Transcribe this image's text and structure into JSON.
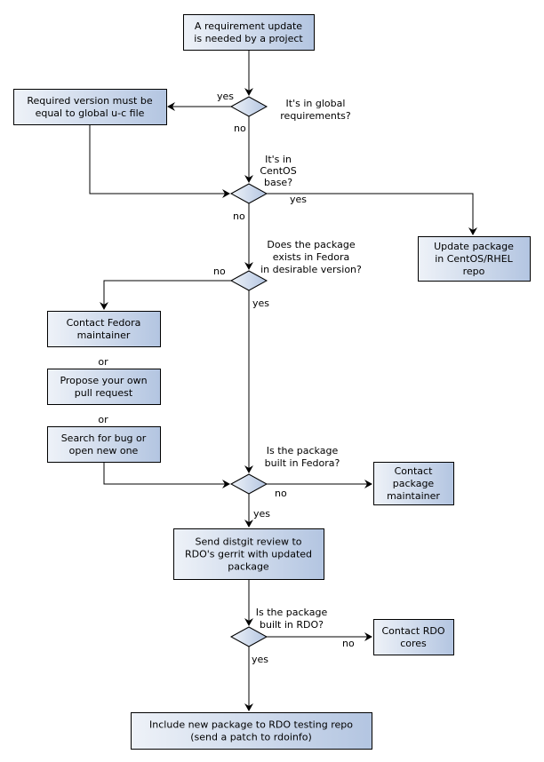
{
  "colors": {
    "fill_light": "#eef2f8",
    "fill_dark": "#b3c5e1",
    "stroke": "#000000"
  },
  "nodes": {
    "start": [
      "A requirement update",
      "is needed by a project"
    ],
    "global_eq": [
      "Required version must be",
      "equal to global u-c file"
    ],
    "update_centos": [
      "Update package",
      "in CentOS/RHEL",
      "repo"
    ],
    "contact_fedora": [
      "Contact Fedora",
      "maintainer"
    ],
    "propose_pr": [
      "Propose your own",
      "pull request"
    ],
    "search_bug": [
      "Search for bug or",
      "open new one"
    ],
    "contact_pkg": [
      "Contact",
      "package",
      "maintainer"
    ],
    "distgit": [
      "Send distgit review to",
      "RDO's gerrit with updated",
      "package"
    ],
    "contact_rdo": [
      "Contact RDO",
      "cores"
    ],
    "include": [
      "Include new package to RDO testing repo",
      "(send a patch to rdoinfo)"
    ]
  },
  "decisions": {
    "d1": [
      "It's in global",
      "requirements?"
    ],
    "d2": [
      "It's in",
      "CentOS",
      "base?"
    ],
    "d3": [
      "Does the package",
      "exists in Fedora",
      "in desirable version?"
    ],
    "d4": [
      "Is the package",
      "built in Fedora?"
    ],
    "d5": [
      "Is the package",
      "built in RDO?"
    ]
  },
  "labels": {
    "yes": "yes",
    "no": "no",
    "or": "or"
  }
}
